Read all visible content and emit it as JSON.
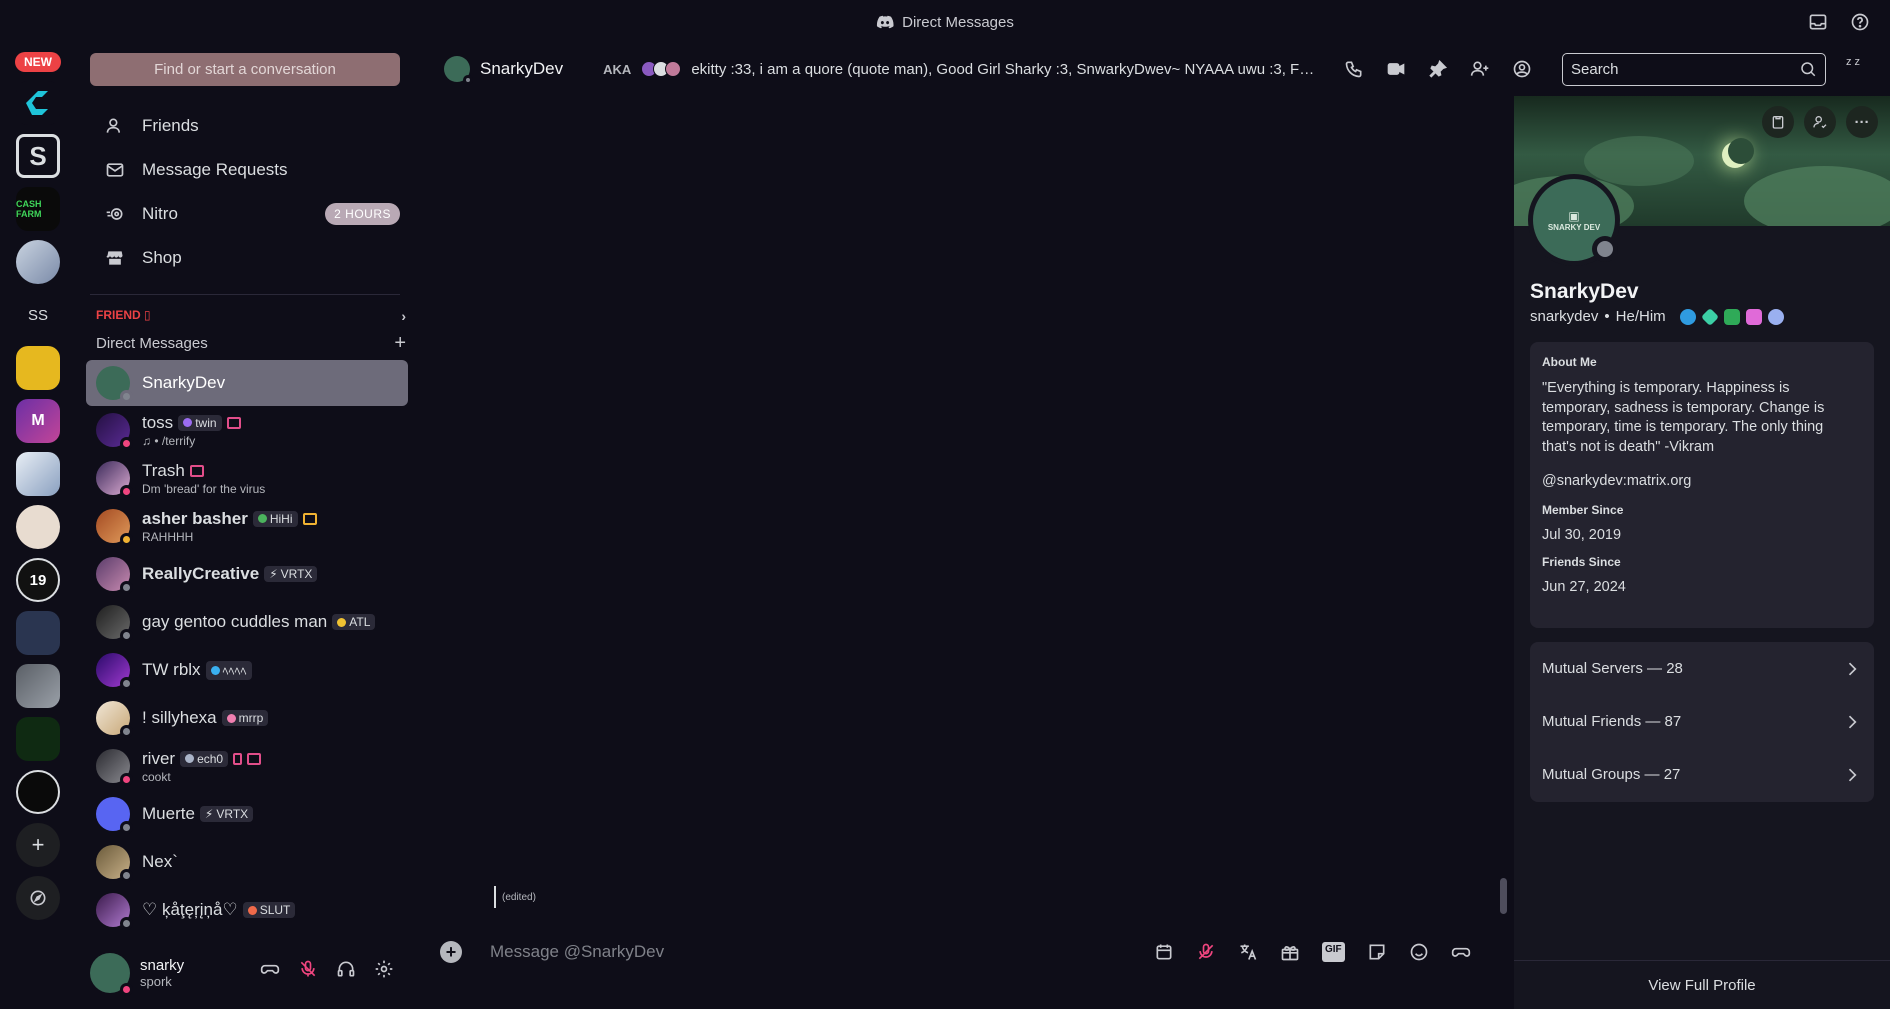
{
  "window": {
    "title": "Direct Messages"
  },
  "servers": {
    "new_badge": "NEW",
    "cash_farm": "CASH FARM",
    "ss": "SS",
    "m": "M",
    "nineteen": "19"
  },
  "sidebar": {
    "find_placeholder": "Find or start a conversation",
    "nav": [
      {
        "label": "Friends",
        "icon": "friends-icon"
      },
      {
        "label": "Message Requests",
        "icon": "envelope-icon"
      },
      {
        "label": "Nitro",
        "icon": "nitro-icon",
        "badge": "2 HOURS"
      },
      {
        "label": "Shop",
        "icon": "shop-icon"
      }
    ],
    "friend_header": "FRIEND ▯",
    "dm_header": "Direct Messages",
    "dms": [
      {
        "name": "SnarkyDev",
        "active": true,
        "status": "#80848e"
      },
      {
        "name": "toss",
        "tag": "twin",
        "sub": "♫ • /terrify",
        "status": "#f0457f"
      },
      {
        "name": "Trash",
        "sub": "Dm 'bread' for the virus",
        "status": "#f0457f"
      },
      {
        "name": "asher basher",
        "tag": "HiHi",
        "sub": "RAHHHH",
        "status": "#f0b232"
      },
      {
        "name": "ReallyCreative",
        "tag": "VRTX",
        "bold": true,
        "status": "#80848e"
      },
      {
        "name": "gay gentoo cuddles man",
        "tag": "ATL",
        "status": "#80848e"
      },
      {
        "name": "TW rblx",
        "tag": "ﾍﾍﾍﾍ",
        "status": "#80848e"
      },
      {
        "name": "! sillyhexa",
        "tag": "mrrp",
        "status": "#80848e"
      },
      {
        "name": "river",
        "tag": "ech0",
        "sub": "cookt",
        "status": "#f0457f"
      },
      {
        "name": "Muerte",
        "tag": "VRTX",
        "status": "#80848e"
      },
      {
        "name": "Nex`",
        "status": "#80848e"
      },
      {
        "name": "♡ ķåţęŗįņå♡",
        "tag": "SLUT",
        "status": "#80848e"
      }
    ]
  },
  "user_panel": {
    "name": "snarky",
    "status": "spork"
  },
  "chat": {
    "name": "SnarkyDev",
    "aka_label": "AKA",
    "aka_list": "ekitty :33, i am a quore (quote man), Good Girl Sharky :3, SnwarkyDwev~ NYAAA uwu :3, Furry...",
    "search_placeholder": "Search",
    "edited": "(edited)",
    "composer_placeholder": "Message @SnarkyDev"
  },
  "profile": {
    "avatar_text": "SNARKY DEV",
    "display_name": "SnarkyDev",
    "username": "snarkydev",
    "pronouns": "He/Him",
    "about_header": "About Me",
    "about_text": "\"Everything is temporary. Happiness is temporary, sadness is temporary. Change is temporary, time is temporary. The only thing that's not is death\" -Vikram",
    "about_link": "@snarkydev:matrix.org",
    "member_since_header": "Member Since",
    "member_since": "Jul 30, 2019",
    "friends_since_header": "Friends Since",
    "friends_since": "Jun 27, 2024",
    "mutual_servers": "Mutual Servers — 28",
    "mutual_friends": "Mutual Friends — 87",
    "mutual_groups": "Mutual Groups — 27",
    "view_full": "View Full Profile"
  },
  "colors": {
    "accent_red": "#ed4245",
    "idle": "#f0b232",
    "dnd": "#f0457f",
    "offline": "#80848e"
  }
}
